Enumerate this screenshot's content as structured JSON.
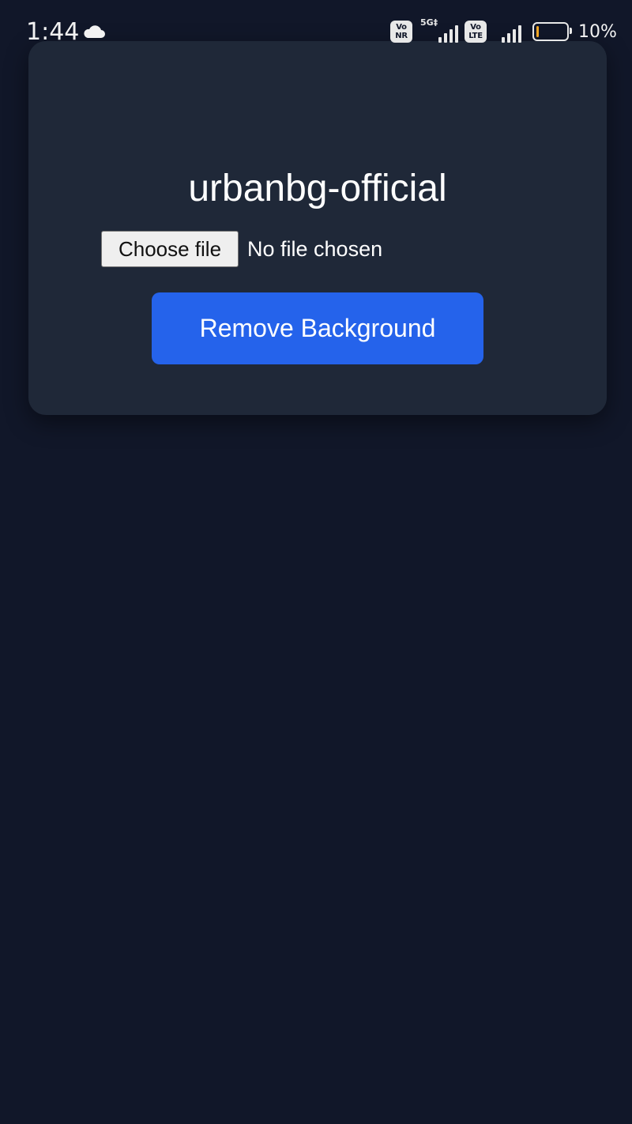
{
  "status_bar": {
    "time": "1:44",
    "vonr_top": "Vo",
    "vonr_bottom": "NR",
    "network_tag": "5G‡",
    "volte_top": "Vo",
    "volte_bottom": "LTE",
    "battery_percent": "10%",
    "battery_level": 0.1,
    "battery_color": "#f5a623",
    "icons": [
      "cloud-icon",
      "vonr-icon",
      "signal-5g-icon",
      "volte-icon",
      "signal-icon",
      "battery-icon"
    ]
  },
  "app": {
    "title": "urbanbg-official",
    "file_input": {
      "button_label": "Choose file",
      "status": "No file chosen"
    },
    "submit_label": "Remove Background"
  },
  "colors": {
    "background": "#111729",
    "card": "#1f2838",
    "accent": "#2563eb"
  }
}
